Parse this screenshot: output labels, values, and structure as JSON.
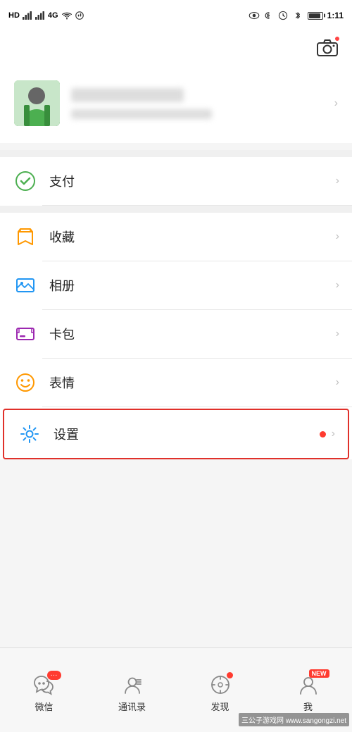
{
  "statusBar": {
    "left": "HD 4G 4G",
    "time": "1:11",
    "batteryIcon": "battery"
  },
  "profile": {
    "avatarAlt": "user avatar",
    "cameraLabel": "camera"
  },
  "menuItems": [
    {
      "id": "pay",
      "icon": "pay-icon",
      "label": "支付",
      "iconColor": "#4CAF50",
      "highlighted": false
    },
    {
      "id": "collect",
      "icon": "collect-icon",
      "label": "收藏",
      "iconColor": "#FF9800",
      "highlighted": false
    },
    {
      "id": "album",
      "icon": "album-icon",
      "label": "相册",
      "iconColor": "#2196F3",
      "highlighted": false
    },
    {
      "id": "card",
      "icon": "card-icon",
      "label": "卡包",
      "iconColor": "#9C27B0",
      "highlighted": false
    },
    {
      "id": "emoji",
      "icon": "emoji-icon",
      "label": "表情",
      "iconColor": "#FF9800",
      "highlighted": false
    },
    {
      "id": "settings",
      "icon": "settings-icon",
      "label": "设置",
      "hasDot": true,
      "iconColor": "#2196F3",
      "highlighted": true
    }
  ],
  "bottomNav": [
    {
      "id": "wechat",
      "label": "微信",
      "icon": "chat-icon",
      "badge": "···",
      "hasBadge": true
    },
    {
      "id": "contacts",
      "label": "通讯录",
      "icon": "contacts-icon",
      "badge": "",
      "hasBadge": false
    },
    {
      "id": "discover",
      "label": "发现",
      "icon": "discover-icon",
      "badge": "",
      "hasDot": true
    },
    {
      "id": "me",
      "label": "我",
      "icon": "me-icon",
      "badge": "NEW",
      "hasNew": true
    }
  ],
  "watermark": {
    "text": "三公子游戏网 www.sangongzi.net"
  }
}
